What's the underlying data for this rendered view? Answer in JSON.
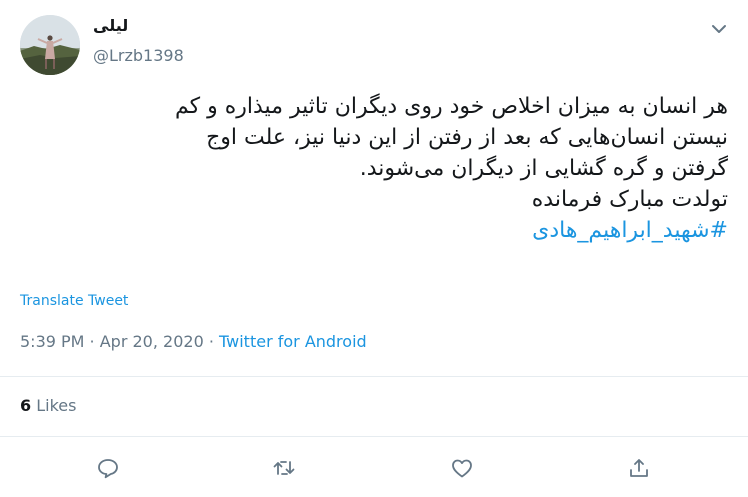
{
  "tweet": {
    "author": {
      "name": "لیلی",
      "handle": "@Lrzb1398"
    },
    "text_lines": [
      "هر انسان به میزان اخلاص خود روی دیگران تاثیر میذاره و کم",
      "نیستن انسان‌هایی که بعد از رفتن از این دنیا نیز، علت اوج",
      "گرفتن و گره گشایی از دیگران می‌شوند.",
      "تولدت مبارک فرمانده"
    ],
    "hashtag": "#شهید_ابراهیم_هادی",
    "translate_label": "Translate Tweet",
    "time": "5:39 PM",
    "separator": " · ",
    "date": "Apr 20, 2020",
    "source": "Twitter for Android",
    "likes": {
      "count": "6",
      "label": " Likes"
    }
  },
  "icons": {
    "menu": "chevron-down-icon",
    "reply": "reply-icon",
    "retweet": "retweet-icon",
    "like": "heart-icon",
    "share": "share-icon"
  },
  "colors": {
    "accent": "#1b95e0",
    "muted": "#657786",
    "text": "#14171a",
    "border": "#e6ecf0"
  }
}
